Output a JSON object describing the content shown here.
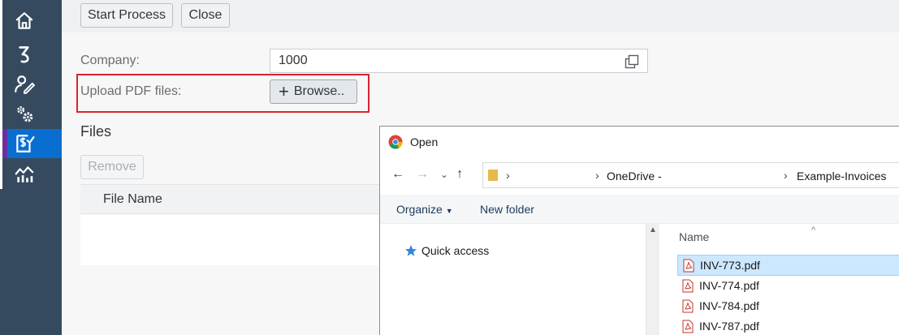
{
  "toolbar": {
    "start_process_label": "Start Process",
    "close_label": "Close"
  },
  "form": {
    "company_label": "Company:",
    "company_value": "1000",
    "upload_label": "Upload PDF files:",
    "browse_label": "Browse.."
  },
  "files_section": {
    "title": "Files",
    "remove_label": "Remove",
    "column_file_name": "File Name"
  },
  "dialog": {
    "title": "Open",
    "address": {
      "segment_onedrive": "OneDrive -",
      "segment_folder": "Example-Invoices"
    },
    "commands": {
      "organize_label": "Organize",
      "new_folder_label": "New folder"
    },
    "nav": {
      "quick_access_label": "Quick access"
    },
    "list": {
      "name_header": "Name",
      "files": [
        {
          "name": "INV-773.pdf",
          "selected": true
        },
        {
          "name": "INV-774.pdf",
          "selected": false
        },
        {
          "name": "INV-784.pdf",
          "selected": false
        },
        {
          "name": "INV-787.pdf",
          "selected": false
        }
      ]
    }
  },
  "colors": {
    "rail_bg": "#354a5f",
    "rail_active": "#0a6ed1",
    "highlight_frame": "#d9252f",
    "selection_bg": "#cce8ff"
  }
}
